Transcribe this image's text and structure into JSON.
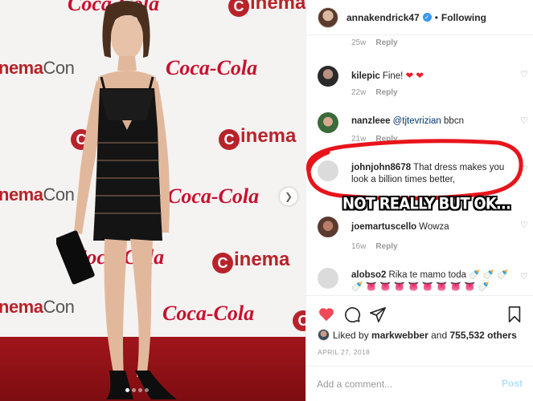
{
  "photo": {
    "wall_logos": {
      "cinemacon": "CinemaCon",
      "cinemacon_cine": "nema",
      "cinemacon_con": "Con",
      "coca_cola": "Coca-Cola",
      "cinema_c": "C",
      "cinema_rest": "inema"
    },
    "carousel": {
      "dots": 4,
      "active_dot": 1
    }
  },
  "header": {
    "username": "annakendrick47",
    "verified": true,
    "separator": "•",
    "follow_state": "Following"
  },
  "comments": [
    {
      "partial": true,
      "age": "25w",
      "reply": "Reply"
    },
    {
      "username": "kilepic",
      "text": "Fine! ",
      "emoji": "❤ ❤",
      "age": "22w",
      "reply": "Reply"
    },
    {
      "username": "nanzleee",
      "mention": "@tjtevrizian",
      "text": " bbcn",
      "age": "21w",
      "reply": "Reply"
    },
    {
      "username": "johnjohn8678",
      "text": "That dress makes you look a billion times better,"
    },
    {
      "username": "joemartuscello",
      "text": "Wowza",
      "age": "16w",
      "reply": "Reply"
    },
    {
      "username": "alobso2",
      "text": "Rika te mamo toda",
      "emoji": "🍼 🍼 🍼 🍼 👅 👅 👅 👅 👅 👅 👅 👅 🍼"
    }
  ],
  "annotation": {
    "text": "NOT REALLY BUT OK...",
    "emoji": "😂",
    "circle_color": "#e8141b"
  },
  "likes": {
    "prefix": "Liked by ",
    "user": "markwebber",
    "middle": " and ",
    "count": "755,532 others"
  },
  "date": "APRIL 27, 2018",
  "add_comment": {
    "placeholder": "Add a comment...",
    "post_label": "Post"
  },
  "colors": {
    "like_red": "#ed4956",
    "link_blue": "#003569",
    "post_disabled": "#b2dffc",
    "verified_blue": "#3897f0"
  },
  "icons": [
    "heart-icon",
    "comment-icon",
    "share-icon",
    "bookmark-icon",
    "chevron-right-icon",
    "verified-icon"
  ]
}
